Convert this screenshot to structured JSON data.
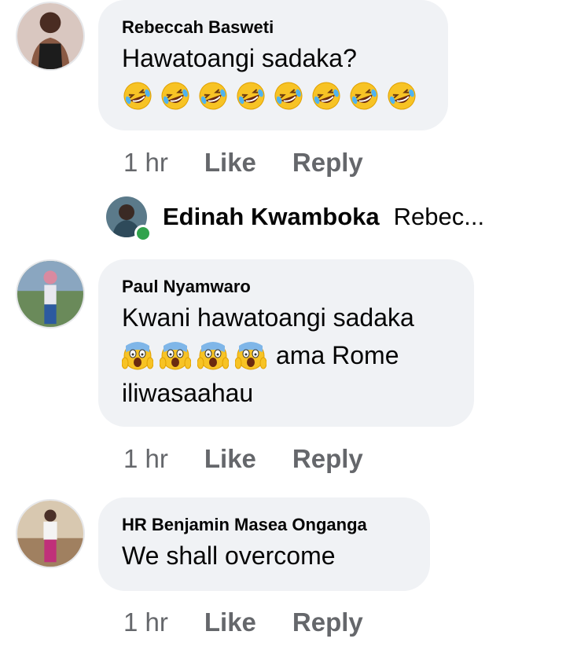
{
  "comments": [
    {
      "author": "Rebeccah Basweti",
      "text": "Hawatoangi sadaka?",
      "emoji_icon": "rolling-on-floor-laughing-emoji",
      "emoji_count": 8,
      "time": "1 hr",
      "like": "Like",
      "reply": "Reply"
    },
    {
      "author": "Paul Nyamwaro",
      "text_line1": "Kwani hawatoangi sadaka",
      "emoji_icon": "face-screaming-in-fear-emoji",
      "emoji_count": 4,
      "text_line2_after_emoji": "ama Rome",
      "text_line3": "iliwasaahau",
      "time": "1 hr",
      "like": "Like",
      "reply": "Reply"
    },
    {
      "author": "HR Benjamin Masea Onganga",
      "text": "We shall overcome",
      "time": "1 hr",
      "like": "Like",
      "reply": "Reply"
    }
  ],
  "reply_preview": {
    "author": "Edinah Kwamboka",
    "preview_text": "Rebec...",
    "online_color": "#31a24c"
  },
  "colors": {
    "bubble": "#f0f2f5",
    "meta_text": "#65676b",
    "text": "#050505"
  }
}
